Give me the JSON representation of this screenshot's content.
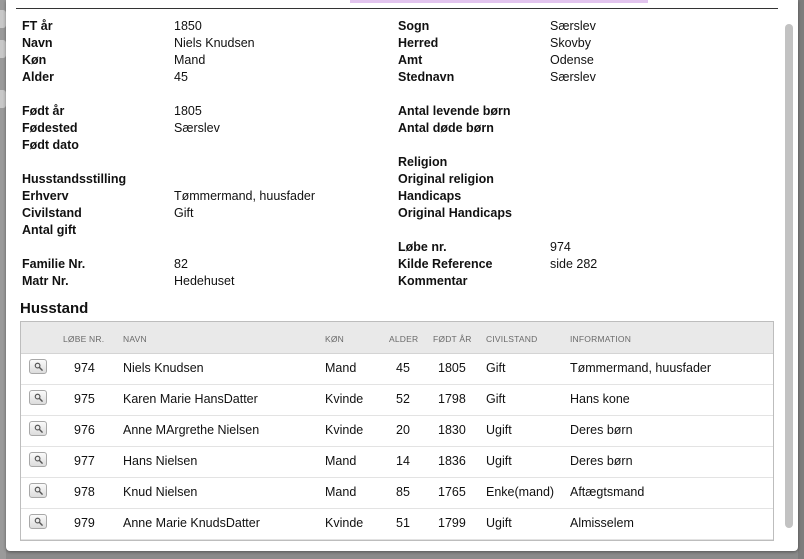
{
  "details": {
    "left": [
      {
        "label": "FT år",
        "value": "1850"
      },
      {
        "label": "Navn",
        "value": "Niels Knudsen"
      },
      {
        "label": "Køn",
        "value": "Mand"
      },
      {
        "label": "Alder",
        "value": "45"
      },
      {
        "label": "Født år",
        "value": "1805"
      },
      {
        "label": "Fødested",
        "value": "Særslev"
      },
      {
        "label": "Født dato",
        "value": ""
      },
      {
        "label": "Husstandsstilling",
        "value": ""
      },
      {
        "label": "Erhverv",
        "value": "Tømmermand, huusfader"
      },
      {
        "label": "Civilstand",
        "value": "Gift"
      },
      {
        "label": "Antal gift",
        "value": ""
      },
      {
        "label": "Familie Nr.",
        "value": "82"
      },
      {
        "label": "Matr Nr.",
        "value": "Hedehuset"
      }
    ],
    "right": [
      {
        "label": "Sogn",
        "value": "Særslev"
      },
      {
        "label": "Herred",
        "value": "Skovby"
      },
      {
        "label": "Amt",
        "value": "Odense"
      },
      {
        "label": "Stednavn",
        "value": "Særslev"
      },
      {
        "label": "Antal levende børn",
        "value": ""
      },
      {
        "label": "Antal døde børn",
        "value": ""
      },
      {
        "label": "Religion",
        "value": ""
      },
      {
        "label": "Original religion",
        "value": ""
      },
      {
        "label": "Handicaps",
        "value": ""
      },
      {
        "label": "Original Handicaps",
        "value": ""
      },
      {
        "label": "Løbe nr.",
        "value": "974"
      },
      {
        "label": "Kilde Reference",
        "value": "side 282"
      },
      {
        "label": "Kommentar",
        "value": ""
      }
    ]
  },
  "household": {
    "title": "Husstand",
    "columns": [
      "LØBE NR.",
      "NAVN",
      "KØN",
      "ALDER",
      "FØDT ÅR",
      "CIVILSTAND",
      "INFORMATION"
    ],
    "rows": [
      {
        "lobe": "974",
        "navn": "Niels Knudsen",
        "kon": "Mand",
        "alder": "45",
        "fodt": "1805",
        "civil": "Gift",
        "info": "Tømmermand, huusfader"
      },
      {
        "lobe": "975",
        "navn": "Karen Marie HansDatter",
        "kon": "Kvinde",
        "alder": "52",
        "fodt": "1798",
        "civil": "Gift",
        "info": "Hans kone"
      },
      {
        "lobe": "976",
        "navn": "Anne MArgrethe Nielsen",
        "kon": "Kvinde",
        "alder": "20",
        "fodt": "1830",
        "civil": "Ugift",
        "info": "Deres børn"
      },
      {
        "lobe": "977",
        "navn": "Hans Nielsen",
        "kon": "Mand",
        "alder": "14",
        "fodt": "1836",
        "civil": "Ugift",
        "info": "Deres børn"
      },
      {
        "lobe": "978",
        "navn": "Knud Nielsen",
        "kon": "Mand",
        "alder": "85",
        "fodt": "1765",
        "civil": "Enke(mand)",
        "info": "Aftægtsmand"
      },
      {
        "lobe": "979",
        "navn": "Anne Marie KnudsDatter",
        "kon": "Kvinde",
        "alder": "51",
        "fodt": "1799",
        "civil": "Ugift",
        "info": "Almisselem"
      }
    ],
    "row_icon": "magnifier-icon"
  },
  "colors": {
    "accent": "#e2c4ee",
    "header_bg": "#e9e9e9",
    "backdrop": "#8a8a8a"
  }
}
